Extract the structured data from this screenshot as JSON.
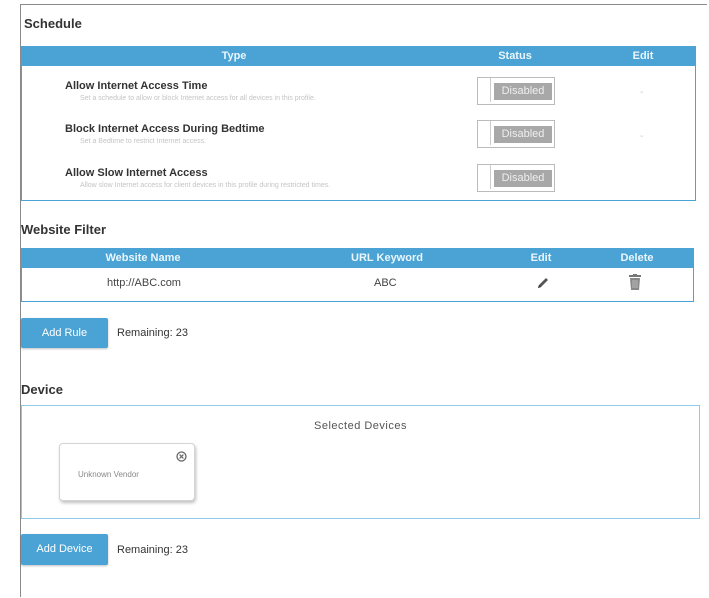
{
  "schedule": {
    "title": "Schedule",
    "headers": {
      "type": "Type",
      "status": "Status",
      "edit": "Edit"
    },
    "rows": [
      {
        "name": "Allow Internet Access Time",
        "description": "Set a schedule to allow or block Internet access for all devices in this profile.",
        "status": "Disabled",
        "edit": "-"
      },
      {
        "name": "Block Internet Access During Bedtime",
        "description": "Set a Bedtime to restrict Internet access.",
        "status": "Disabled",
        "edit": "-"
      },
      {
        "name": "Allow Slow Internet Access",
        "description": "Allow slow Internet access for client devices in this profile during restricted times.",
        "status": "Disabled",
        "edit": ""
      }
    ]
  },
  "website_filter": {
    "title": "Website Filter",
    "headers": {
      "website_name": "Website Name",
      "url_keyword": "URL Keyword",
      "edit": "Edit",
      "delete": "Delete"
    },
    "rows": [
      {
        "website_name": "http://ABC.com",
        "url_keyword": "ABC"
      }
    ],
    "add_rule_label": "Add Rule",
    "remaining": "Remaining: 23"
  },
  "device": {
    "title": "Device",
    "selected_devices_label": "Selected Devices",
    "devices": [
      {
        "name": "Unknown Vendor"
      }
    ],
    "add_device_label": "Add Device",
    "remaining": "Remaining: 23"
  },
  "colors": {
    "accent": "#4aa3d4",
    "toggle_disabled": "#a8a8a8"
  },
  "icons": {
    "edit": "pencil-icon",
    "delete": "trash-icon",
    "close": "close-circle-icon"
  }
}
